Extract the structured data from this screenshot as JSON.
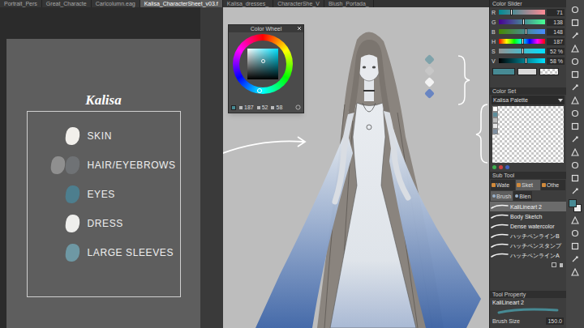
{
  "tabs": [
    {
      "label": "Portrait_Pers",
      "selected": false
    },
    {
      "label": "Great_Characte",
      "selected": false
    },
    {
      "label": "Carlcolumn.eag",
      "selected": false
    },
    {
      "label": "Kalisa_CharacterSheet_v03.f",
      "selected": true
    },
    {
      "label": "Kalisa_dresses_",
      "selected": false
    },
    {
      "label": "CharacterShe_V",
      "selected": false
    },
    {
      "label": "Blush_Portada_",
      "selected": false
    }
  ],
  "sheet": {
    "title": "Kalisa",
    "items": [
      {
        "label": "SKIN",
        "swatches": [
          {
            "color": "#f1efeb"
          }
        ]
      },
      {
        "label": "HAIR/EYEBROWS",
        "swatches": [
          {
            "color": "#8f8f8f"
          },
          {
            "color": "#6f7275"
          }
        ]
      },
      {
        "label": "EYES",
        "swatches": [
          {
            "color": "#4d7e8e"
          }
        ]
      },
      {
        "label": "DRESS",
        "swatches": [
          {
            "color": "#eeeeec"
          }
        ]
      },
      {
        "label": "LARGE SLEEVES",
        "swatches": [
          {
            "color": "#6e98a4"
          }
        ]
      }
    ]
  },
  "color_wheel": {
    "title": "Color Wheel",
    "values": [
      {
        "value": "187",
        "level": 0.519
      },
      {
        "value": "52",
        "level": 0.52
      },
      {
        "value": "58",
        "level": 0.58
      }
    ]
  },
  "color_slider": {
    "title": "Color Slider",
    "rows": [
      {
        "label": "R",
        "value": "71",
        "level": 0.278,
        "kind": "red"
      },
      {
        "label": "G",
        "value": "138",
        "level": 0.541,
        "kind": "green"
      },
      {
        "label": "B",
        "value": "148",
        "level": 0.58,
        "kind": "blue"
      },
      {
        "label": "H",
        "value": "187",
        "level": 0.519,
        "kind": "hue"
      },
      {
        "label": "S",
        "value": "52 %",
        "level": 0.52,
        "kind": "saturation"
      },
      {
        "label": "V",
        "value": "58 %",
        "level": 0.58,
        "kind": "value"
      }
    ]
  },
  "color_set": {
    "title": "Color Set",
    "palette_name": "Kalisa Palette",
    "swatches": [
      {
        "color": "#ffffff"
      },
      {
        "color": "#5f8e9b"
      },
      {
        "color": "#bdbdbd"
      },
      {
        "color": "#e8e8e8"
      },
      {
        "color": "#7e8fa0"
      }
    ]
  },
  "sub_tool": {
    "title": "Sub Tool",
    "groups": [
      {
        "label": "Wate",
        "selected": false
      },
      {
        "label": "Sket",
        "selected": true
      },
      {
        "label": "Othe",
        "selected": false
      }
    ],
    "tabs": [
      {
        "label": "Brush",
        "selected": true
      },
      {
        "label": "Blen",
        "selected": false
      }
    ],
    "brushes": [
      {
        "label": "KaliLineart 2",
        "selected": true
      },
      {
        "label": "Body Sketch",
        "selected": false
      },
      {
        "label": "Dense watercolor",
        "selected": false
      },
      {
        "label": "ハッチペンラインB",
        "selected": false
      },
      {
        "label": "ハッチペンスタンプ",
        "selected": false
      },
      {
        "label": "ハッチペンラインA",
        "selected": false
      }
    ]
  },
  "tool_property": {
    "title": "Tool Property",
    "brush_name": "KaliLineart 2",
    "size_label": "Brush Size",
    "size_value": "150.0"
  }
}
